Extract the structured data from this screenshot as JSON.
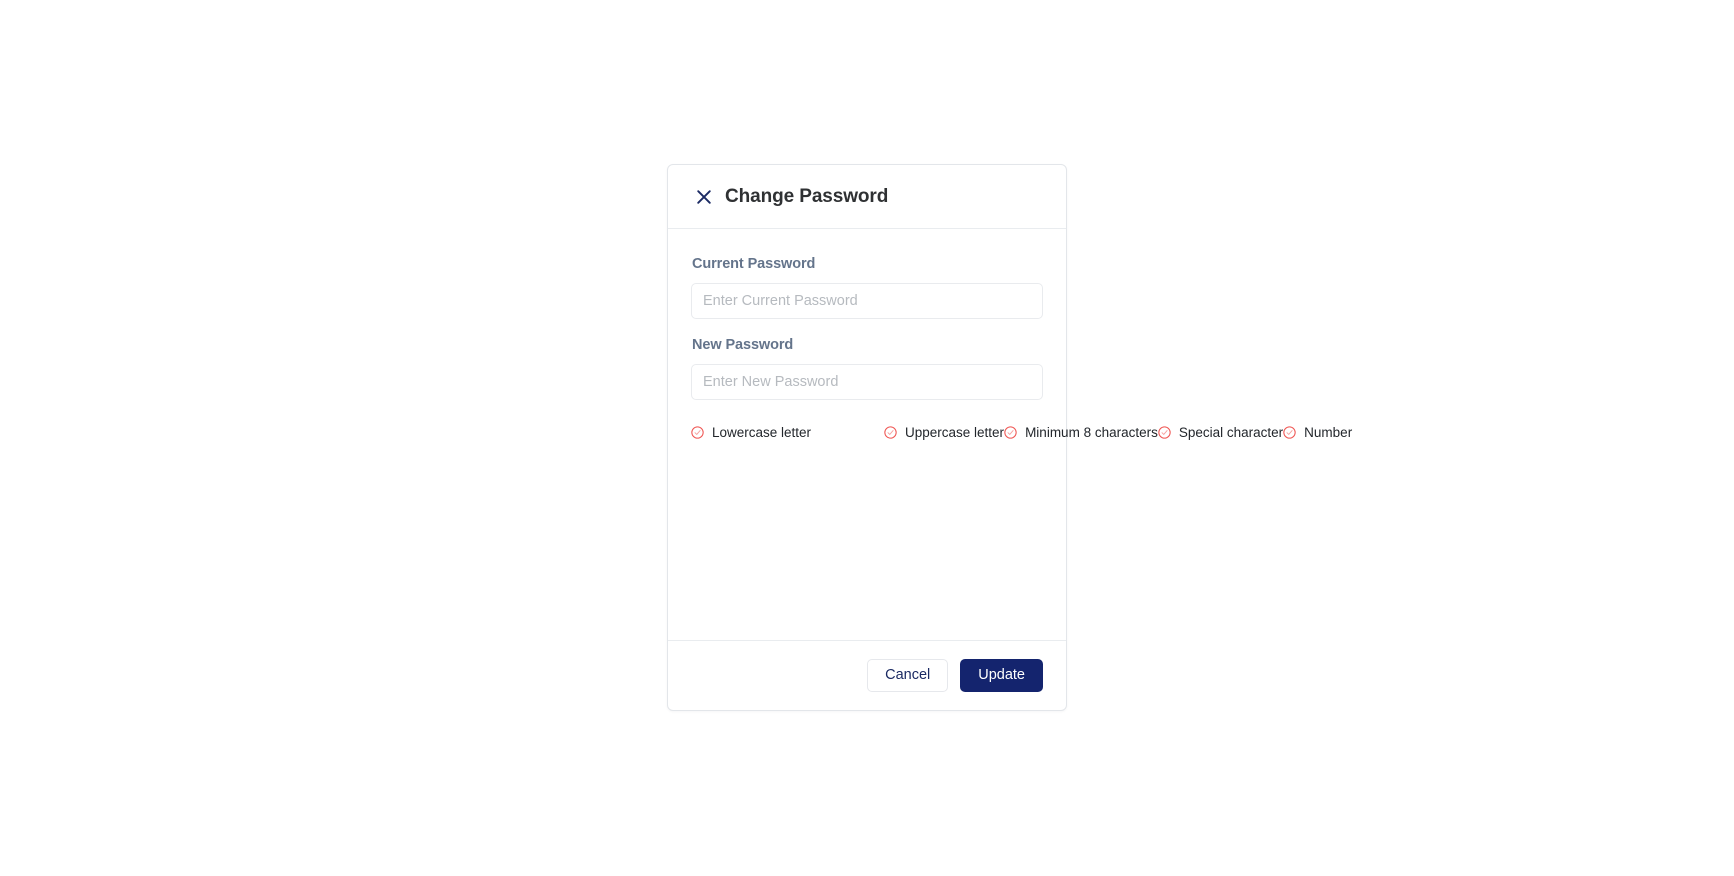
{
  "modal": {
    "title": "Change Password",
    "close_icon": "close-icon",
    "fields": [
      {
        "label": "Current Password",
        "placeholder": "Enter Current Password",
        "value": "",
        "name": "current-password"
      },
      {
        "label": "New Password",
        "placeholder": "Enter New Password",
        "value": "",
        "name": "new-password"
      }
    ],
    "requirements": {
      "icon": "check-circle-icon",
      "icon_color": "#ef5350",
      "items": [
        "Lowercase letter",
        "Uppercase letter",
        "Minimum 8 characters",
        "Special character",
        "Number"
      ]
    },
    "footer": {
      "cancel_label": "Cancel",
      "update_label": "Update",
      "update_color": "#14246e"
    }
  }
}
